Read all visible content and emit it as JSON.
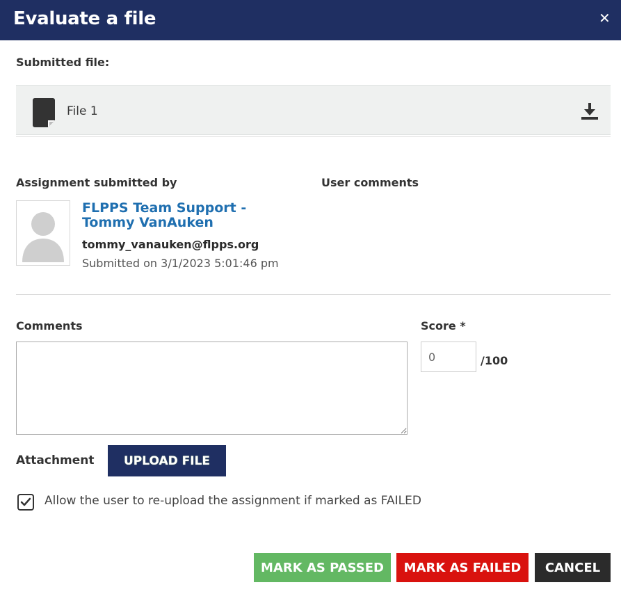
{
  "header": {
    "title": "Evaluate a file",
    "close_icon": "close-icon",
    "background_color": "#1f2f62"
  },
  "submitted_file": {
    "label": "Submitted file:",
    "file_name": "File 1",
    "file_icon": "file-icon",
    "download_icon": "download-icon"
  },
  "submission": {
    "submitted_by_label": "Assignment submitted by",
    "user_comments_label": "User comments",
    "user_name": "FLPPS Team Support - Tommy VanAuken",
    "user_email": "tommy_vanauken@flpps.org",
    "submitted_on": "Submitted on 3/1/2023 5:01:46 pm",
    "avatar_icon": "avatar-placeholder-icon"
  },
  "evaluation": {
    "comments_label": "Comments",
    "comments_value": "",
    "score_label": "Score *",
    "score_value": "0",
    "score_max": "/100",
    "attachment_label": "Attachment",
    "upload_button": "UPLOAD FILE",
    "reupload_checkbox_label": "Allow the user to re-upload the assignment if marked as FAILED",
    "reupload_checked": true
  },
  "actions": {
    "passed_label": "MARK AS PASSED",
    "failed_label": "MARK AS FAILED",
    "cancel_label": "CANCEL",
    "passed_color": "#63b863",
    "failed_color": "#d9120e",
    "cancel_color": "#2b2b2b"
  }
}
